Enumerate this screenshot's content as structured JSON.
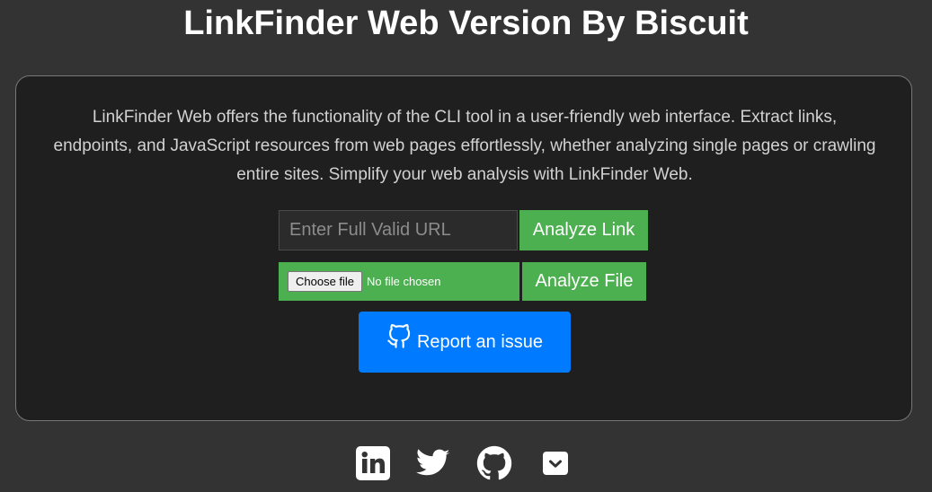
{
  "header": {
    "title": "LinkFinder Web Version By Biscuit"
  },
  "main": {
    "description": "LinkFinder Web offers the functionality of the CLI tool in a user-friendly web interface. Extract links, endpoints, and JavaScript resources from web pages effortlessly, whether analyzing single pages or crawling entire sites. Simplify your web analysis with LinkFinder Web.",
    "url_input": {
      "placeholder": "Enter Full Valid URL",
      "value": ""
    },
    "analyze_link_label": "Analyze Link",
    "file_input": {
      "choose_label": "Choose file",
      "status": "No file chosen"
    },
    "analyze_file_label": "Analyze File",
    "report_issue": {
      "label": "Report an issue",
      "icon": "github-icon"
    }
  },
  "footer": {
    "social_icons": [
      "linkedin-icon",
      "twitter-icon",
      "github-icon",
      "pocket-icon"
    ]
  },
  "colors": {
    "background": "#333333",
    "card_background": "#1f1f1f",
    "green_button": "#4caf50",
    "blue_button": "#007bff",
    "text": "#ffffff"
  }
}
